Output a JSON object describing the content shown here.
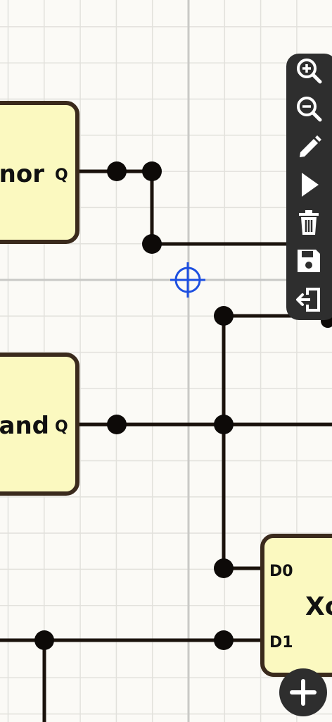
{
  "gates": {
    "xnor": {
      "name": "nor",
      "output": "Q"
    },
    "nand": {
      "name": "and",
      "output": "Q"
    },
    "mux": {
      "name": "Xo",
      "inputs": [
        "D0",
        "D1"
      ]
    }
  },
  "toolbar": {
    "tools": [
      "zoom-in-icon",
      "zoom-out-icon",
      "pencil-icon",
      "play-icon",
      "trash-icon",
      "save-icon",
      "exit-icon"
    ]
  },
  "add_button": {
    "icon": "plus-icon"
  },
  "colors": {
    "background": "#fbfaf6",
    "gate_fill": "#fbf9c0",
    "gate_border": "#3a2a1c",
    "wire": "#1a120c",
    "cursor": "#1d4fe0",
    "toolbar": "#2e2e2e"
  }
}
